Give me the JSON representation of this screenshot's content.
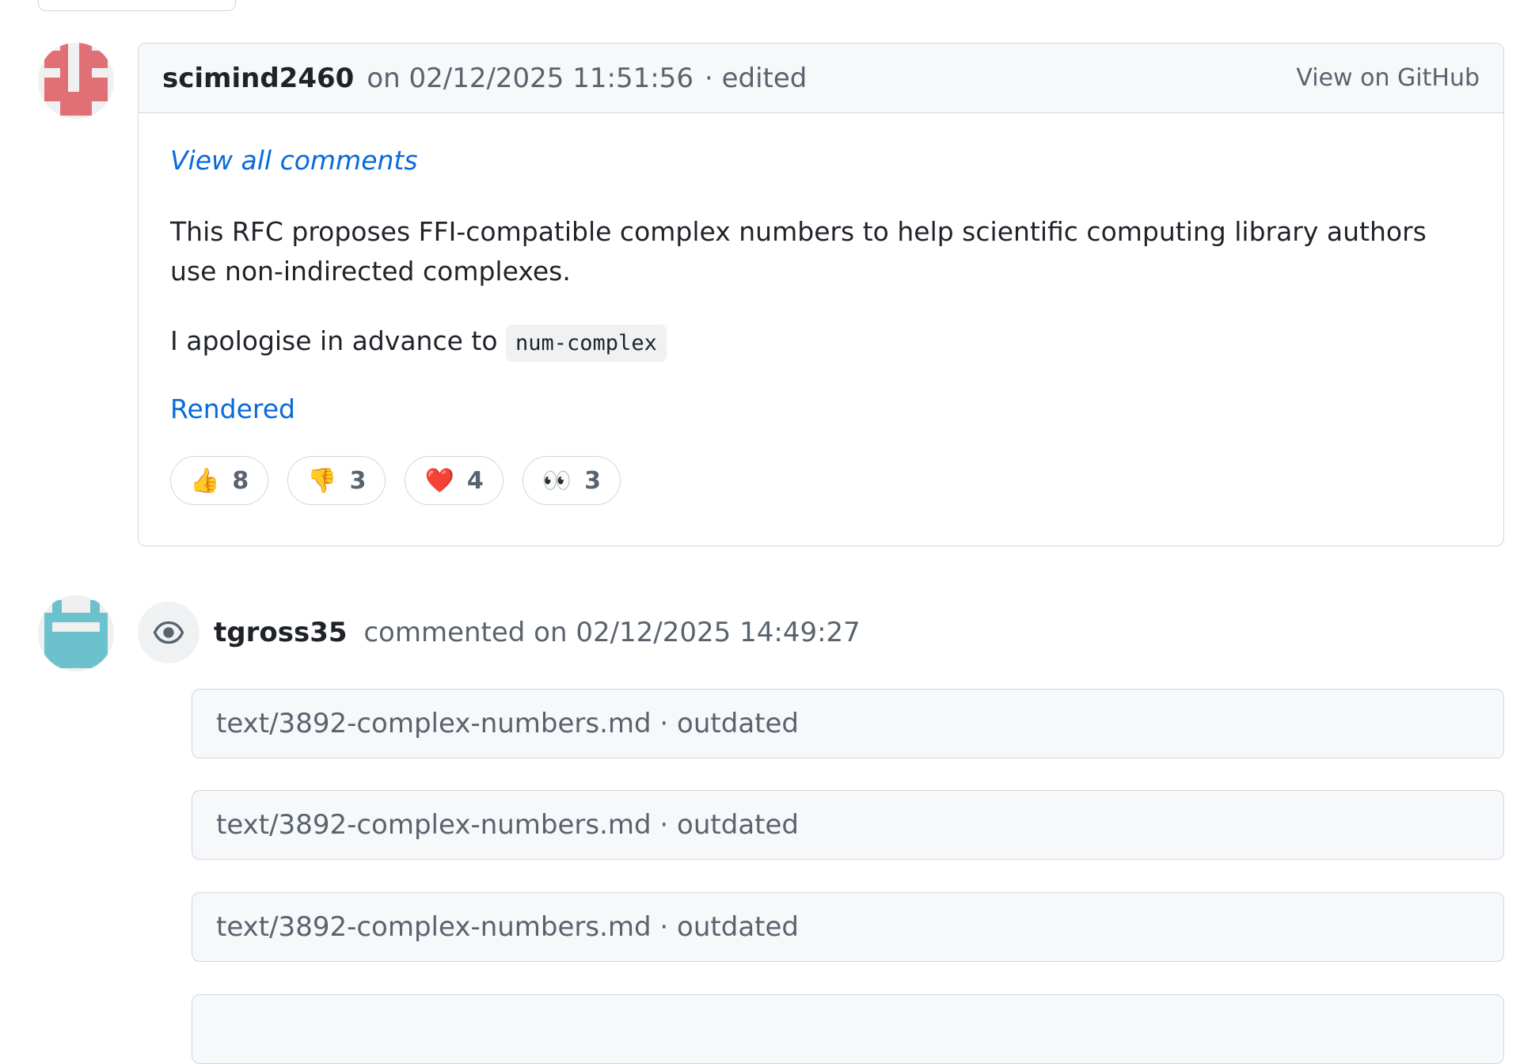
{
  "comment": {
    "author": "scimind2460",
    "timestamp": "on 02/12/2025 11:51:56",
    "edited": "· edited",
    "view_on_github": "View on GitHub",
    "view_all_comments": "View all comments",
    "paragraph1": "This RFC proposes FFI-compatible complex numbers to help scientific computing library authors use non-indirected complexes.",
    "paragraph2_text": "I apologise in advance to ",
    "paragraph2_code": "num-complex",
    "rendered_link": "Rendered",
    "reactions": [
      {
        "emoji": "👍",
        "count": "8",
        "icon": "thumbs-up-icon"
      },
      {
        "emoji": "👎",
        "count": "3",
        "icon": "thumbs-down-icon"
      },
      {
        "emoji": "❤️",
        "count": "4",
        "icon": "heart-icon"
      },
      {
        "emoji": "👀",
        "count": "3",
        "icon": "eyes-icon"
      }
    ],
    "avatar_color": "#e17076"
  },
  "event": {
    "author": "tgross35",
    "action": "commented on 02/12/2025 14:49:27",
    "icon": "eye-icon",
    "avatar_color": "#6cc2cc",
    "files": [
      {
        "label": "text/3892-complex-numbers.md · outdated"
      },
      {
        "label": "text/3892-complex-numbers.md · outdated"
      },
      {
        "label": "text/3892-complex-numbers.md · outdated"
      }
    ]
  }
}
